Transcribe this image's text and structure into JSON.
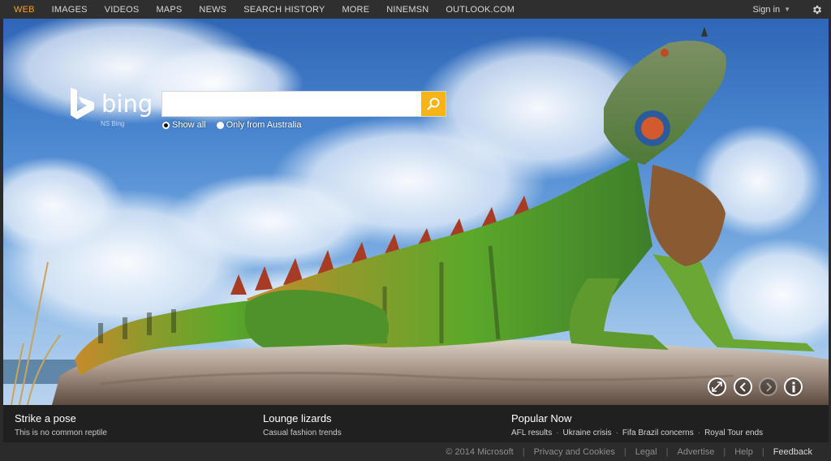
{
  "nav": {
    "items": [
      "WEB",
      "IMAGES",
      "VIDEOS",
      "MAPS",
      "NEWS",
      "SEARCH HISTORY",
      "MORE",
      "NINEMSN",
      "OUTLOOK.COM"
    ],
    "active_index": 0,
    "signin": "Sign in"
  },
  "logo": {
    "word": "bing",
    "sub": "NS Bing"
  },
  "search": {
    "value": "",
    "placeholder": ""
  },
  "radios": {
    "all": "Show all",
    "australia": "Only from Australia",
    "selected": "all"
  },
  "info": {
    "left": {
      "title": "Strike a pose",
      "sub": "This is no common reptile"
    },
    "middle": {
      "title": "Lounge lizards",
      "sub": "Casual fashion trends"
    },
    "right": {
      "title": "Popular Now",
      "trends": [
        "AFL results",
        "Ukraine crisis",
        "Fifa Brazil concerns",
        "Royal Tour ends"
      ]
    }
  },
  "footer": {
    "copyright": "© 2014 Microsoft",
    "links": [
      "Privacy and Cookies",
      "Legal",
      "Advertise",
      "Help",
      "Feedback"
    ]
  },
  "colors": {
    "accent": "#f7a21b",
    "search_button": "#f7b417",
    "topbar": "#2f2f2f"
  },
  "icons": [
    "gear-icon",
    "search-icon",
    "expand-icon",
    "prev-icon",
    "next-icon",
    "info-icon",
    "bing-logo-icon"
  ]
}
